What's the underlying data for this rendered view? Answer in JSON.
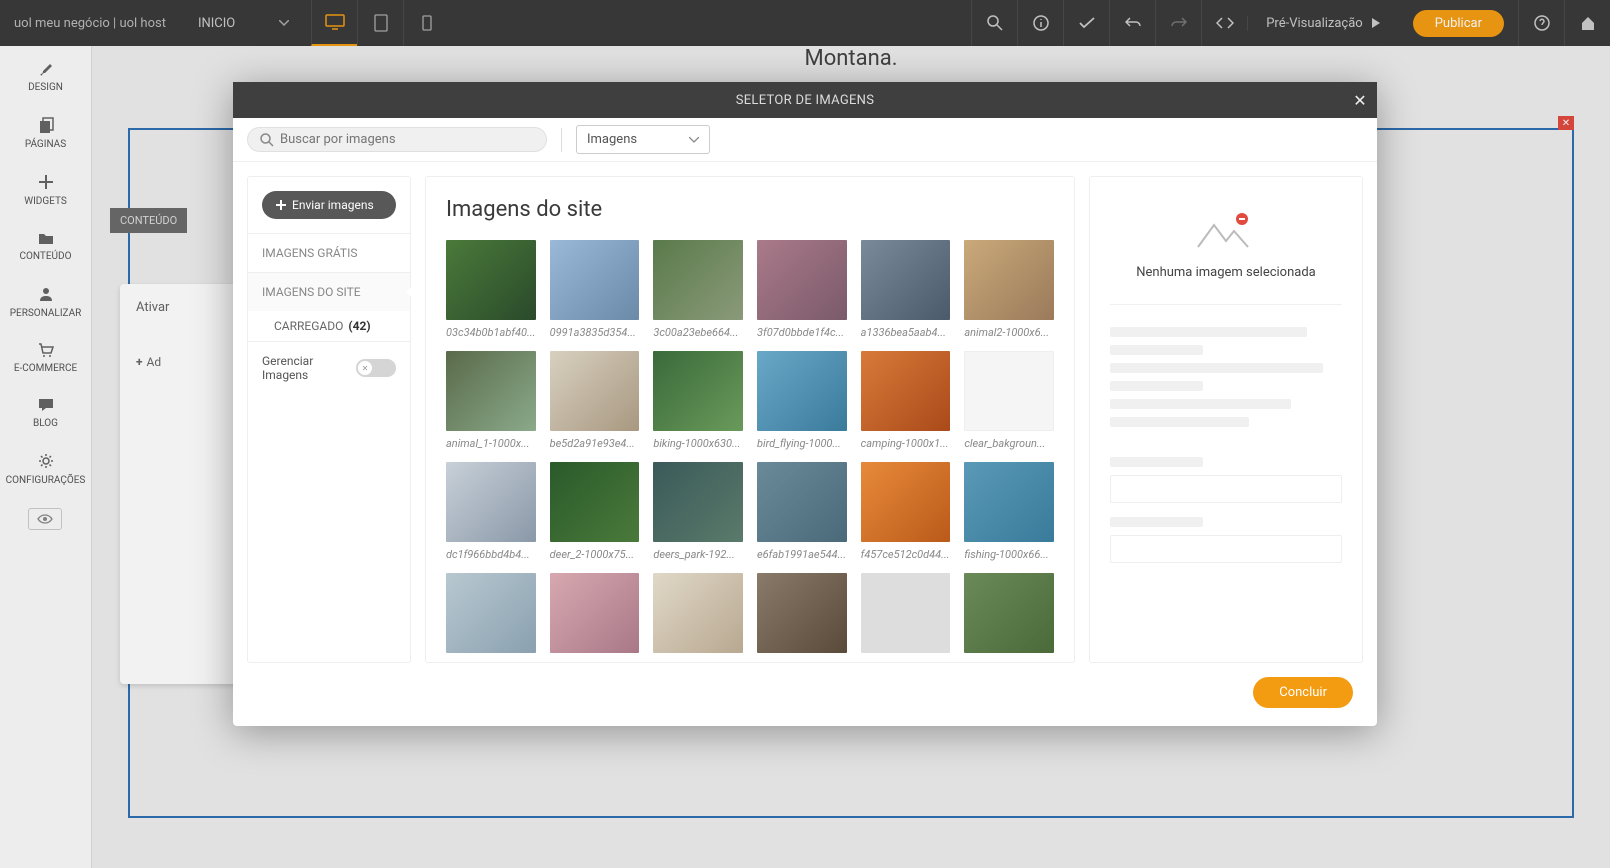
{
  "topbar": {
    "brand": "uol meu negócio | uol host",
    "page": "INICIO",
    "preview": "Pré-Visualização",
    "publish": "Publicar"
  },
  "leftrail": {
    "items": [
      {
        "label": "DESIGN"
      },
      {
        "label": "PÁGINAS"
      },
      {
        "label": "WIDGETS"
      },
      {
        "label": "CONTEÚDO"
      },
      {
        "label": "PERSONALIZAR"
      },
      {
        "label": "E-COMMERCE"
      },
      {
        "label": "BLOG"
      },
      {
        "label": "CONFIGURAÇÕES"
      }
    ]
  },
  "canvas": {
    "heading": "Montana.",
    "content_tag": "CONTEÚDO",
    "activate": "Ativar",
    "add": "Ad"
  },
  "modal": {
    "title": "SELETOR DE IMAGENS",
    "search_placeholder": "Buscar por imagens",
    "type_label": "Imagens",
    "left": {
      "upload": "Enviar imagens",
      "free": "IMAGENS GRÁTIS",
      "site": "IMAGENS DO SITE",
      "loaded": "CARREGADO",
      "loaded_count": "(42)",
      "manage": "Gerenciar Imagens"
    },
    "center": {
      "title": "Imagens do site",
      "images": [
        {
          "name": "03c34b0b1abf40..."
        },
        {
          "name": "0991a3835d354..."
        },
        {
          "name": "3c00a23ebe664..."
        },
        {
          "name": "3f07d0bbde1f4c..."
        },
        {
          "name": "a1336bea5aab4..."
        },
        {
          "name": "animal2-1000x6..."
        },
        {
          "name": "animal_1-1000x..."
        },
        {
          "name": "be5d2a91e93e4..."
        },
        {
          "name": "biking-1000x630..."
        },
        {
          "name": "bird_flying-1000..."
        },
        {
          "name": "camping-1000x1..."
        },
        {
          "name": "clear_bakgroun..."
        },
        {
          "name": "dc1f966bbd4b4..."
        },
        {
          "name": "deer_2-1000x75..."
        },
        {
          "name": "deers_park-192..."
        },
        {
          "name": "e6fab1991ae544..."
        },
        {
          "name": "f457ce512c0d44..."
        },
        {
          "name": "fishing-1000x66..."
        },
        {
          "name": ""
        },
        {
          "name": ""
        },
        {
          "name": ""
        },
        {
          "name": ""
        },
        {
          "name": ""
        },
        {
          "name": ""
        }
      ]
    },
    "right": {
      "none": "Nenhuma imagem selecionada"
    },
    "done": "Concluir"
  }
}
